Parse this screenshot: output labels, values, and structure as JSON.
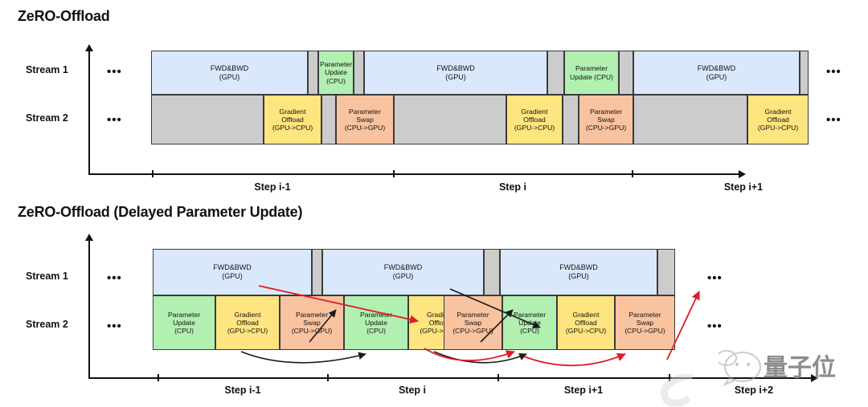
{
  "panels": [
    {
      "title": "ZeRO-Offload",
      "stream_labels": [
        "Stream 1",
        "Stream 2"
      ],
      "continuation_marker": "•••",
      "axis_ticks": [
        "Step i-1",
        "Step i",
        "Step i+1"
      ],
      "stream1_blocks": [
        {
          "label": "FWD&BWD\n(GPU)",
          "kind": "fwdbwd",
          "color": "#dae8fc"
        },
        {
          "label": "",
          "kind": "idle",
          "color": "#cccccc"
        },
        {
          "label": "Parameter\nUpdate (CPU)",
          "kind": "param-update",
          "color": "#b2f0b2"
        },
        {
          "label": "",
          "kind": "idle",
          "color": "#cccccc"
        },
        {
          "label": "FWD&BWD\n(GPU)",
          "kind": "fwdbwd",
          "color": "#dae8fc"
        },
        {
          "label": "",
          "kind": "idle",
          "color": "#cccccc"
        },
        {
          "label": "Parameter\nUpdate (CPU)",
          "kind": "param-update",
          "color": "#b2f0b2"
        },
        {
          "label": "",
          "kind": "idle",
          "color": "#cccccc"
        },
        {
          "label": "FWD&BWD\n(GPU)",
          "kind": "fwdbwd",
          "color": "#dae8fc"
        },
        {
          "label": "",
          "kind": "idle",
          "color": "#cccccc"
        }
      ],
      "stream2_blocks": [
        {
          "label": "",
          "kind": "idle",
          "color": "#cccccc"
        },
        {
          "label": "Gradient\nOffload\n(GPU->CPU)",
          "kind": "gradient-offload",
          "color": "#ffe57f"
        },
        {
          "label": "",
          "kind": "idle",
          "color": "#cccccc"
        },
        {
          "label": "Parameter\nSwap\n(CPU->GPU)",
          "kind": "parameter-swap",
          "color": "#fac3a0"
        },
        {
          "label": "",
          "kind": "idle",
          "color": "#cccccc"
        },
        {
          "label": "Gradient\nOffload\n(GPU->CPU)",
          "kind": "gradient-offload",
          "color": "#ffe57f"
        },
        {
          "label": "",
          "kind": "idle",
          "color": "#cccccc"
        },
        {
          "label": "Parameter\nSwap\n(CPU->GPU)",
          "kind": "parameter-swap",
          "color": "#fac3a0"
        },
        {
          "label": "",
          "kind": "idle",
          "color": "#cccccc"
        },
        {
          "label": "Gradient\nOffload\n(GPU->CPU)",
          "kind": "gradient-offload",
          "color": "#ffe57f"
        }
      ]
    },
    {
      "title": "ZeRO-Offload (Delayed Parameter Update)",
      "stream_labels": [
        "Stream 1",
        "Stream 2"
      ],
      "continuation_marker": "•••",
      "axis_ticks": [
        "Step i-1",
        "Step i",
        "Step i+1",
        "Step i+2"
      ],
      "stream1_blocks": [
        {
          "label": "FWD&BWD\n(GPU)",
          "kind": "fwdbwd",
          "color": "#dae8fc"
        },
        {
          "label": "",
          "kind": "idle",
          "color": "#cccccc"
        },
        {
          "label": "FWD&BWD\n(GPU)",
          "kind": "fwdbwd",
          "color": "#dae8fc"
        },
        {
          "label": "",
          "kind": "idle",
          "color": "#cccccc"
        },
        {
          "label": "FWD&BWD\n(GPU)",
          "kind": "fwdbwd",
          "color": "#dae8fc"
        },
        {
          "label": "",
          "kind": "idle",
          "color": "#cccccc"
        }
      ],
      "stream2_blocks": [
        {
          "label": "Parameter\nUpdate\n(CPU)",
          "kind": "param-update",
          "color": "#b2f0b2"
        },
        {
          "label": "Gradient\nOffload\n(GPU->CPU)",
          "kind": "gradient-offload",
          "color": "#ffe57f"
        },
        {
          "label": "Parameter\nSwap\n(CPU->GPU)",
          "kind": "parameter-swap",
          "color": "#fac3a0"
        },
        {
          "label": "Parameter\nUpdate\n(CPU)",
          "kind": "param-update",
          "color": "#b2f0b2"
        },
        {
          "label": "Gradient\nOffload\n(GPU->CPU)",
          "kind": "gradient-offload",
          "color": "#ffe57f"
        },
        {
          "label": "Parameter\nSwap\n(CPU->GPU)",
          "kind": "parameter-swap",
          "color": "#fac3a0"
        },
        {
          "label": "Parameter\nUpdate\n(CPU)",
          "kind": "param-update",
          "color": "#b2f0b2"
        },
        {
          "label": "Gradient\nOffload\n(GPU->CPU)",
          "kind": "gradient-offload",
          "color": "#ffe57f"
        },
        {
          "label": "Parameter\nSwap\n(CPU->GPU)",
          "kind": "parameter-swap",
          "color": "#fac3a0"
        }
      ]
    }
  ],
  "watermark": {
    "text": "量子位"
  },
  "palette": {
    "fwdbwd": "#dae8fc",
    "param_update": "#b2f0b2",
    "gradient_offload": "#ffe57f",
    "parameter_swap": "#fac3a0",
    "idle": "#cccccc",
    "stroke": "#3a3a3a",
    "axis": "#111111",
    "arrow_red": "#e01b24",
    "arrow_black": "#1a1a1a"
  }
}
